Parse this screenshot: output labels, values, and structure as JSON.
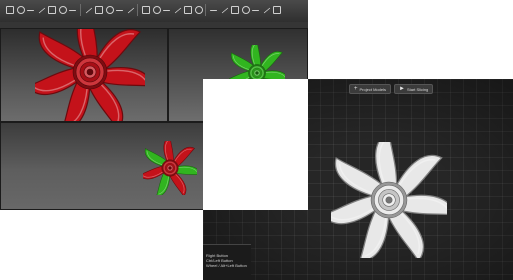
{
  "cad_window": {
    "toolbar_icons": [
      "shade-icon",
      "wire-icon",
      "rotate-icon",
      "pan-icon",
      "zoom-icon",
      "fit-icon",
      "view-icon",
      "section-icon",
      "render-icon",
      "measure-icon",
      "sketch-icon",
      "line-icon",
      "arc-icon",
      "circle-icon",
      "rect-icon",
      "trim-icon",
      "extend-icon",
      "mirror-icon",
      "pattern-icon",
      "grid-icon",
      "snap-icon",
      "layer-icon",
      "color-icon",
      "print-icon",
      "close-icon"
    ],
    "viewports": [
      {
        "name": "viewport-top-left",
        "fan_color": "#c4121a"
      },
      {
        "name": "viewport-top-right",
        "fan_color": "#31b51f"
      },
      {
        "name": "viewport-bottom",
        "fan_colors": [
          "#c4121a",
          "#31b51f"
        ]
      }
    ]
  },
  "viewer_window": {
    "buttons": [
      {
        "icon": "+",
        "label": "Project Models"
      },
      {
        "icon": "►",
        "label": "Start Slicing"
      }
    ],
    "fan_color": "#e8e8e8",
    "help_lines": [
      "Right Button",
      "Ctrl/Left Button",
      "Wheel / Alt+Left Button"
    ]
  }
}
